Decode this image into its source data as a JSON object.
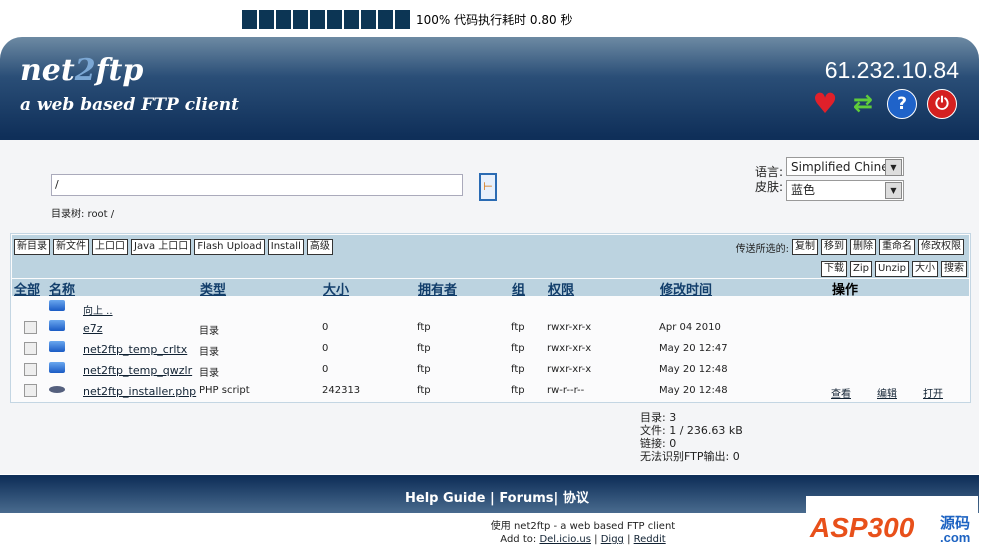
{
  "progress": {
    "percent": 100,
    "text": "100% 代码执行耗时 0.80 秒"
  },
  "header": {
    "logo_main_a": "net",
    "logo_main_b": "2",
    "logo_main_c": "ftp",
    "logo_sub": "a web based FTP client",
    "ip": "61.232.10.84",
    "icons": [
      "heart-icon",
      "refresh-icon",
      "help-icon",
      "logout-icon"
    ]
  },
  "nav": {
    "path_value": "/",
    "dirtree_label": "目录树: root /",
    "language_label": "语言:",
    "language_value": "Simplified Chine:",
    "skin_label": "皮肤:",
    "skin_value": "蓝色"
  },
  "toolbar": {
    "left_buttons": [
      "新目录",
      "新文件",
      "上口口",
      "Java 上口口",
      "Flash Upload",
      "Install",
      "高级"
    ],
    "selected_label": "传送所选的:",
    "right_buttons_1": [
      "复制",
      "移到",
      "删除",
      "重命名",
      "修改权限"
    ],
    "right_buttons_2": [
      "下载",
      "Zip",
      "Unzip",
      "大小",
      "搜索"
    ]
  },
  "table": {
    "headers": {
      "all": "全部",
      "name": "名称",
      "type": "类型",
      "size": "大小",
      "owner": "拥有者",
      "group": "组",
      "perms": "权限",
      "mtime": "修改时间",
      "actions": "操作"
    },
    "up_label": "向上 ..",
    "rows": [
      {
        "name": "e7z",
        "type": "目录",
        "size": "0",
        "owner": "ftp",
        "group": "ftp",
        "perms": "rwxr-xr-x",
        "mtime": "Apr 04 2010",
        "icon": "folder"
      },
      {
        "name": "net2ftp_temp_crltx",
        "type": "目录",
        "size": "0",
        "owner": "ftp",
        "group": "ftp",
        "perms": "rwxr-xr-x",
        "mtime": "May 20 12:47",
        "icon": "folder"
      },
      {
        "name": "net2ftp_temp_qwzlr",
        "type": "目录",
        "size": "0",
        "owner": "ftp",
        "group": "ftp",
        "perms": "rwxr-xr-x",
        "mtime": "May 20 12:48",
        "icon": "folder"
      },
      {
        "name": "net2ftp_installer.php",
        "type": "PHP script",
        "size": "242313",
        "owner": "ftp",
        "group": "ftp",
        "perms": "rw-r--r--",
        "mtime": "May 20 12:48",
        "icon": "php",
        "actions": [
          "查看",
          "编辑",
          "打开"
        ]
      }
    ]
  },
  "summary": [
    "目录: 3",
    "文件: 1 / 236.63 kB",
    "链接: 0",
    "无法识别FTP输出: 0"
  ],
  "footer": {
    "help": "Help Guide",
    "forums": "Forums",
    "license": "协议",
    "credit": "使用 net2ftp - a web based FTP client",
    "addto": "Add to:",
    "links": [
      "Del.icio.us",
      "Digg",
      "Reddit"
    ]
  },
  "watermark": {
    "text": "ASP300",
    "sub": "源码",
    "com": ".com"
  }
}
